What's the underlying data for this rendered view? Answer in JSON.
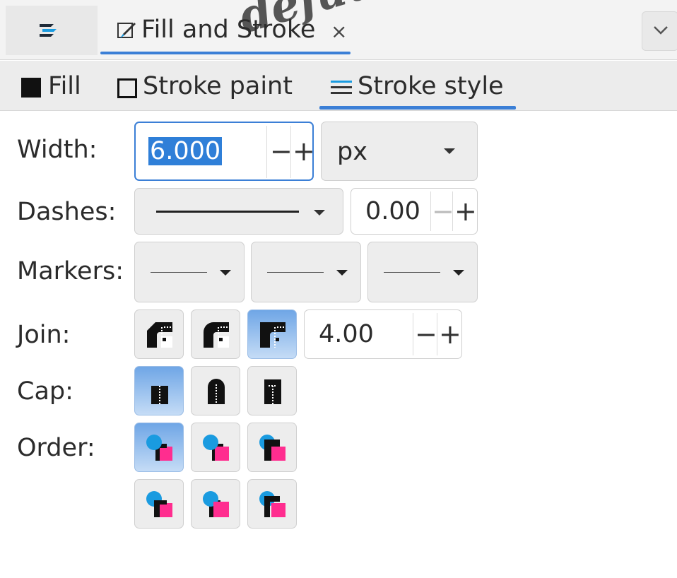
{
  "tabs": {
    "stack_icon": "stack-icon",
    "fill_stroke": {
      "label": "Fill and Stroke",
      "close": "×"
    },
    "menu_icon": "chevron-down-icon"
  },
  "subtabs": {
    "fill": "Fill",
    "stroke_paint": "Stroke paint",
    "stroke_style": "Stroke style"
  },
  "width": {
    "label": "Width:",
    "value": "6.000",
    "minus": "−",
    "plus": "+",
    "unit": "px"
  },
  "dashes": {
    "label": "Dashes:",
    "offset": "0.00",
    "minus": "−",
    "plus": "+"
  },
  "markers": {
    "label": "Markers:"
  },
  "join": {
    "label": "Join:",
    "miter_limit": "4.00",
    "minus": "−",
    "plus": "+",
    "active": "miter"
  },
  "cap": {
    "label": "Cap:",
    "active": "butt"
  },
  "order": {
    "label": "Order:",
    "active": 0
  },
  "watermark": "default watermark",
  "colors": {
    "accent": "#3b7fd6",
    "marker_blue": "#1a9be0",
    "marker_pink": "#ff2d8f"
  }
}
